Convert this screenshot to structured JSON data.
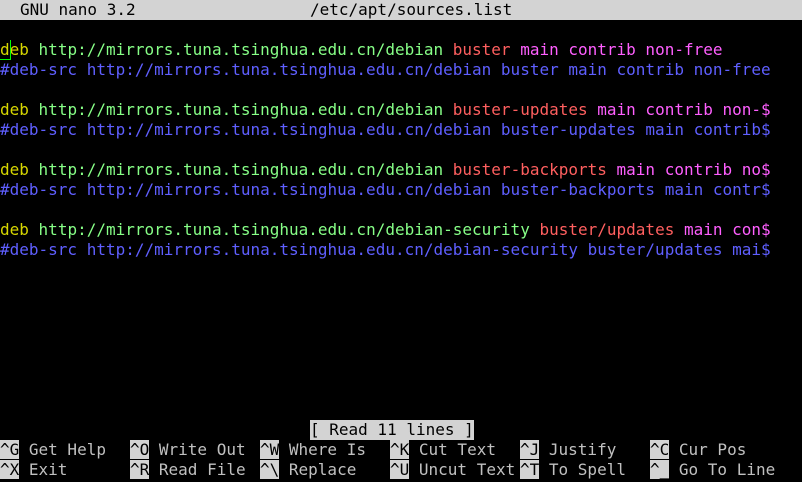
{
  "window": {
    "app_name": "GNU nano 3.2",
    "file_path": "/etc/apt/sources.list"
  },
  "colors": {
    "deb": "#d7d700",
    "deb_src": "#5f5fff",
    "url": "#87ff87",
    "suite": "#ff5f5f",
    "component": "#ff5fff"
  },
  "lines": [
    {
      "type": "deb",
      "keyword": "deb",
      "url": "http://mirrors.tuna.tsinghua.edu.cn/debian",
      "suite": "buster",
      "rest": "main contrib non-free"
    },
    {
      "type": "deb-src",
      "keyword": "#deb-src",
      "url": "http://mirrors.tuna.tsinghua.edu.cn/debian",
      "suite": "buster",
      "rest": "main contrib non-free"
    },
    {
      "type": "blank"
    },
    {
      "type": "deb",
      "keyword": "deb",
      "url": "http://mirrors.tuna.tsinghua.edu.cn/debian",
      "suite": "buster-updates",
      "rest": "main contrib non-$"
    },
    {
      "type": "deb-src",
      "keyword": "#deb-src",
      "url": "http://mirrors.tuna.tsinghua.edu.cn/debian",
      "suite": "buster-updates",
      "rest": "main contrib$"
    },
    {
      "type": "blank"
    },
    {
      "type": "deb",
      "keyword": "deb",
      "url": "http://mirrors.tuna.tsinghua.edu.cn/debian",
      "suite": "buster-backports",
      "rest": "main contrib no$"
    },
    {
      "type": "deb-src",
      "keyword": "#deb-src",
      "url": "http://mirrors.tuna.tsinghua.edu.cn/debian",
      "suite": "buster-backports",
      "rest": "main contr$"
    },
    {
      "type": "blank"
    },
    {
      "type": "deb",
      "keyword": "deb",
      "url": "http://mirrors.tuna.tsinghua.edu.cn/debian-security",
      "suite": "buster/updates",
      "rest": "main con$"
    },
    {
      "type": "deb-src",
      "keyword": "#deb-src",
      "url": "http://mirrors.tuna.tsinghua.edu.cn/debian-security",
      "suite": "buster/updates",
      "rest": "mai$"
    }
  ],
  "status_message": "[ Read 11 lines ]",
  "shortcuts_row1": [
    {
      "key": "^G",
      "label": "Get Help"
    },
    {
      "key": "^O",
      "label": "Write Out"
    },
    {
      "key": "^W",
      "label": "Where Is"
    },
    {
      "key": "^K",
      "label": "Cut Text"
    },
    {
      "key": "^J",
      "label": "Justify"
    },
    {
      "key": "^C",
      "label": "Cur Pos"
    }
  ],
  "shortcuts_row2": [
    {
      "key": "^X",
      "label": "Exit"
    },
    {
      "key": "^R",
      "label": "Read File"
    },
    {
      "key": "^\\",
      "label": "Replace"
    },
    {
      "key": "^U",
      "label": "Uncut Text"
    },
    {
      "key": "^T",
      "label": "To Spell"
    },
    {
      "key": "^_",
      "label": "Go To Line"
    }
  ]
}
